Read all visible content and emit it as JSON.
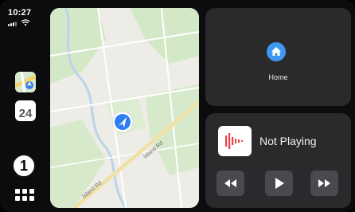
{
  "status": {
    "time": "10:27"
  },
  "sidebar": {
    "apps": [
      {
        "name": "Maps",
        "icon": "maps-icon"
      },
      {
        "name": "Calendar",
        "icon": "calendar-icon",
        "day": "24"
      }
    ],
    "badge": "1",
    "app_grid_icon": "grid-icon"
  },
  "map": {
    "road_labels": [
      "Island Rd",
      "Island Rd"
    ],
    "colors": {
      "land": "#f0eee8",
      "park": "#cfe6c0",
      "water": "#b7d3ec",
      "road": "#ffffff",
      "major_road": "#f3e3a6",
      "location": "#2f7df3"
    }
  },
  "home_card": {
    "label": "Home",
    "icon": "home-icon",
    "accent": "#3f98f0"
  },
  "now_playing": {
    "title": "Not Playing",
    "art_icon": "audio-waveform-icon",
    "art_color": "#e8424a",
    "controls": [
      "rewind-icon",
      "play-icon",
      "fast-forward-icon"
    ]
  }
}
